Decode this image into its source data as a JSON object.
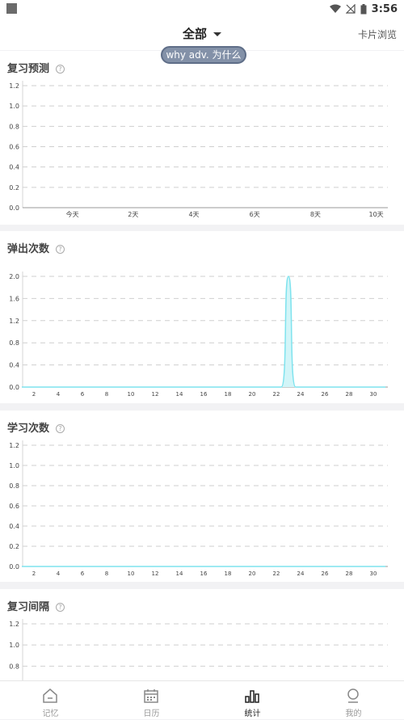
{
  "status": {
    "time": "3:56"
  },
  "header": {
    "title": "全部",
    "right_link": "卡片浏览"
  },
  "toast": "why adv. 为什么",
  "charts": [
    {
      "title": "复习预测",
      "help": "?"
    },
    {
      "title": "弹出次数",
      "help": "?"
    },
    {
      "title": "学习次数",
      "help": "?"
    },
    {
      "title": "复习间隔",
      "help": "?"
    }
  ],
  "chart_data": [
    {
      "type": "line",
      "title": "复习预测",
      "y_ticks": [
        "0.0",
        "0.2",
        "0.4",
        "0.6",
        "0.8",
        "1.0",
        "1.2"
      ],
      "ylim": [
        0,
        1.2
      ],
      "x_ticks": [
        "今天",
        "2天",
        "4天",
        "6天",
        "8天",
        "10天"
      ],
      "x": [
        0,
        1,
        2,
        3,
        4,
        5,
        6,
        7,
        8,
        9,
        10
      ],
      "values": [
        0,
        0,
        0,
        0,
        0,
        0,
        0,
        0,
        0,
        0,
        0
      ]
    },
    {
      "type": "area",
      "title": "弹出次数",
      "y_ticks": [
        "0.0",
        "0.4",
        "0.8",
        "1.2",
        "1.6",
        "2.0"
      ],
      "ylim": [
        0,
        2.0
      ],
      "x_ticks": [
        "2",
        "4",
        "6",
        "8",
        "10",
        "12",
        "14",
        "16",
        "18",
        "20",
        "22",
        "24",
        "26",
        "28",
        "30"
      ],
      "xlim": [
        1,
        31
      ],
      "x": [
        1,
        2,
        3,
        4,
        5,
        6,
        7,
        8,
        9,
        10,
        11,
        12,
        13,
        14,
        15,
        16,
        17,
        18,
        19,
        20,
        21,
        22,
        23,
        24,
        25,
        26,
        27,
        28,
        29,
        30,
        31
      ],
      "values": [
        0,
        0,
        0,
        0,
        0,
        0,
        0,
        0,
        0,
        0,
        0,
        0,
        0,
        0,
        0,
        0,
        0,
        0,
        0,
        0,
        0,
        0,
        2,
        0,
        0,
        0,
        0,
        0,
        0,
        0,
        0
      ],
      "color": "#7fe3ee"
    },
    {
      "type": "line",
      "title": "学习次数",
      "y_ticks": [
        "0.0",
        "0.2",
        "0.4",
        "0.6",
        "0.8",
        "1.0",
        "1.2"
      ],
      "ylim": [
        0,
        1.2
      ],
      "x_ticks": [
        "2",
        "4",
        "6",
        "8",
        "10",
        "12",
        "14",
        "16",
        "18",
        "20",
        "22",
        "24",
        "26",
        "28",
        "30"
      ],
      "xlim": [
        1,
        31
      ],
      "x": [
        1,
        31
      ],
      "values": [
        0,
        0
      ],
      "color": "#7fe3ee"
    },
    {
      "type": "line",
      "title": "复习间隔",
      "y_ticks": [
        "0.8",
        "1.0",
        "1.2"
      ],
      "ylim": [
        0,
        1.2
      ]
    }
  ],
  "tabbar": [
    {
      "label": "记忆",
      "icon": "home-icon"
    },
    {
      "label": "日历",
      "icon": "calendar-icon"
    },
    {
      "label": "统计",
      "icon": "stats-icon"
    },
    {
      "label": "我的",
      "icon": "profile-icon"
    }
  ]
}
